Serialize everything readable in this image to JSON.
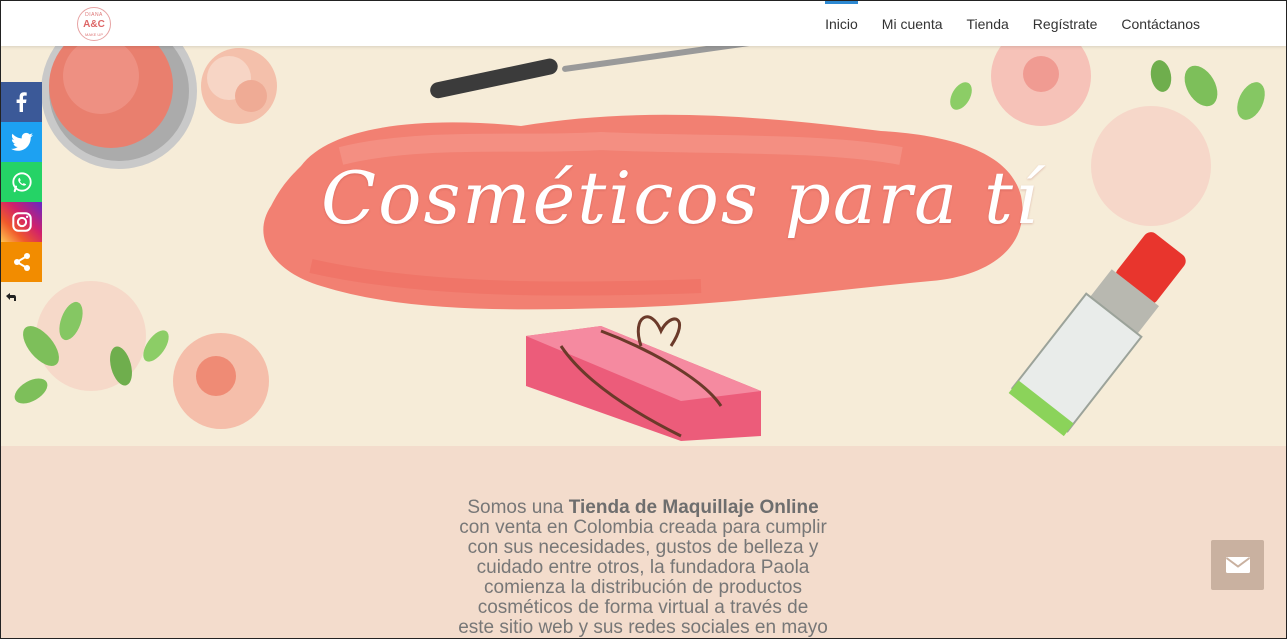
{
  "header": {
    "logo_text_top": "DIANA",
    "logo_text_mid": "A&C",
    "logo_text_bottom": "MAKE UP",
    "nav": [
      {
        "label": "Inicio",
        "active": true
      },
      {
        "label": "Mi cuenta",
        "active": false
      },
      {
        "label": "Tienda",
        "active": false
      },
      {
        "label": "Regístrate",
        "active": false
      },
      {
        "label": "Contáctanos",
        "active": false
      }
    ]
  },
  "hero": {
    "title": "Cosméticos para tí"
  },
  "social": {
    "buttons": [
      "facebook-icon",
      "twitter-icon",
      "whatsapp-icon",
      "instagram-icon",
      "share-icon"
    ],
    "hide_toggle_icon": "hand-pointer-icon"
  },
  "about": {
    "lines": [
      {
        "pre": "Somos una ",
        "bold": "Tienda de Maquillaje Online",
        "post": ""
      },
      {
        "pre": "con venta en Colombia creada para cumplir",
        "bold": "",
        "post": ""
      },
      {
        "pre": "con sus necesidades, gustos de belleza y",
        "bold": "",
        "post": ""
      },
      {
        "pre": "cuidado entre otros,  la fundadora Paola",
        "bold": "",
        "post": ""
      },
      {
        "pre": "comienza la distribución de productos",
        "bold": "",
        "post": ""
      },
      {
        "pre": "cosméticos de forma virtual a través de",
        "bold": "",
        "post": ""
      },
      {
        "pre": "este sitio web y sus redes sociales en mayo",
        "bold": "",
        "post": ""
      }
    ]
  },
  "contact_button": {
    "icon": "envelope-icon"
  },
  "colors": {
    "accent": "#2d89d2",
    "hero_bg": "#f6ecd8",
    "about_bg": "#f3dccc",
    "brush": "#f27467"
  }
}
